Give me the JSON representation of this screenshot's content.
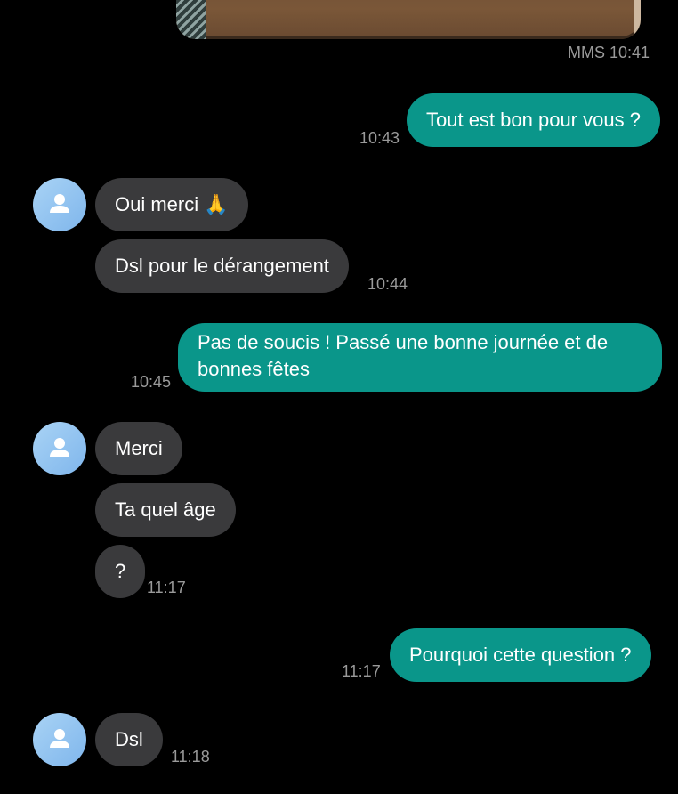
{
  "header": {
    "mms_time": "MMS 10:41"
  },
  "messages": [
    {
      "dir": "out",
      "text": "Tout est bon pour vous ?",
      "time": "10:43"
    },
    {
      "dir": "in",
      "text": "Oui merci 🙏",
      "time": ""
    },
    {
      "dir": "in",
      "text": "Dsl pour le dérangement",
      "time": "10:44"
    },
    {
      "dir": "out",
      "text": "Pas de soucis ! Passé une bonne journée et de bonnes fêtes",
      "time": "10:45"
    },
    {
      "dir": "in",
      "text": "Merci",
      "time": ""
    },
    {
      "dir": "in",
      "text": "Ta quel âge",
      "time": ""
    },
    {
      "dir": "in",
      "text": "?",
      "time": "11:17"
    },
    {
      "dir": "out",
      "text": "Pourquoi cette question ?",
      "time": "11:17"
    },
    {
      "dir": "in",
      "text": "Dsl",
      "time": "11:18"
    }
  ],
  "icons": {
    "avatar": "person-icon"
  },
  "colors": {
    "outgoing_bubble": "#0a968a",
    "incoming_bubble": "#3a3a3c",
    "background": "#000000"
  }
}
